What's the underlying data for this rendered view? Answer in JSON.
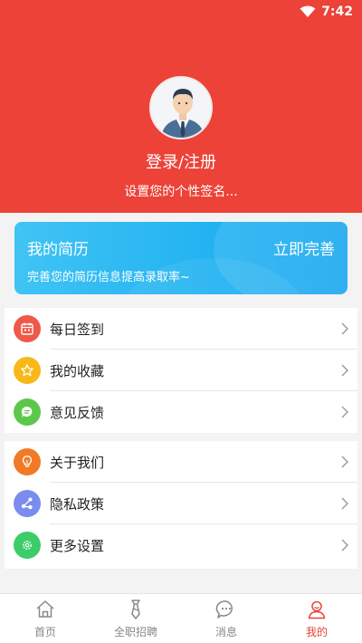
{
  "status_bar": {
    "time": "7:42"
  },
  "header": {
    "login_text": "登录/注册",
    "signature_text": "设置您的个性签名...",
    "bg_color": "#ec4238"
  },
  "resume_card": {
    "title": "我的简历",
    "action": "立即完善",
    "description": "完善您的简历信息提高录取率~"
  },
  "menu_group_1": [
    {
      "label": "每日签到",
      "icon": "calendar-icon",
      "color": "#f0584a"
    },
    {
      "label": "我的收藏",
      "icon": "star-icon",
      "color": "#f8b818"
    },
    {
      "label": "意见反馈",
      "icon": "message-icon",
      "color": "#5cc84a"
    }
  ],
  "menu_group_2": [
    {
      "label": "关于我们",
      "icon": "lightbulb-icon",
      "color": "#f07a26"
    },
    {
      "label": "隐私政策",
      "icon": "share-icon",
      "color": "#7a8cf0"
    },
    {
      "label": "更多设置",
      "icon": "gear-icon",
      "color": "#3ccc6a"
    }
  ],
  "tabbar": {
    "tabs": [
      {
        "label": "首页",
        "icon": "home-icon"
      },
      {
        "label": "全职招聘",
        "icon": "tie-icon"
      },
      {
        "label": "消息",
        "icon": "chat-icon"
      },
      {
        "label": "我的",
        "icon": "user-icon"
      }
    ],
    "active_index": 3,
    "active_color": "#e8433a"
  }
}
